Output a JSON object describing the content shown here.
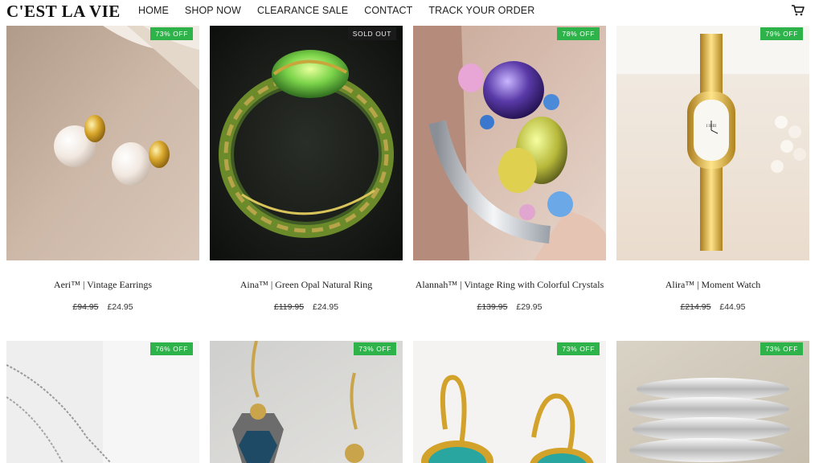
{
  "header": {
    "logo": "C'EST LA VIE",
    "nav": [
      "HOME",
      "SHOP NOW",
      "CLEARANCE SALE",
      "CONTACT",
      "TRACK YOUR ORDER"
    ],
    "cart_icon": "cart-icon"
  },
  "products": [
    {
      "title": "Aeri™ | Vintage Earrings",
      "old_price": "£94.95",
      "price": "£24.95",
      "badge": "73% OFF",
      "sold_out": false
    },
    {
      "title": "Aina™ | Green Opal Natural Ring",
      "old_price": "£119.95",
      "price": "£24.95",
      "badge": "SOLD OUT",
      "sold_out": true
    },
    {
      "title": "Alannah™ | Vintage Ring with Colorful Crystals",
      "old_price": "£139.95",
      "price": "£29.95",
      "badge": "78% OFF",
      "sold_out": false
    },
    {
      "title": "Alira™ | Moment Watch",
      "old_price": "£214.95",
      "price": "£44.95",
      "badge": "79% OFF",
      "sold_out": false
    },
    {
      "badge": "76% OFF"
    },
    {
      "badge": "73% OFF"
    },
    {
      "badge": "73% OFF"
    },
    {
      "badge": "73% OFF"
    }
  ],
  "colors": {
    "badge_green": "#2db34a",
    "sold_out_badge": "#1a1a1a"
  }
}
